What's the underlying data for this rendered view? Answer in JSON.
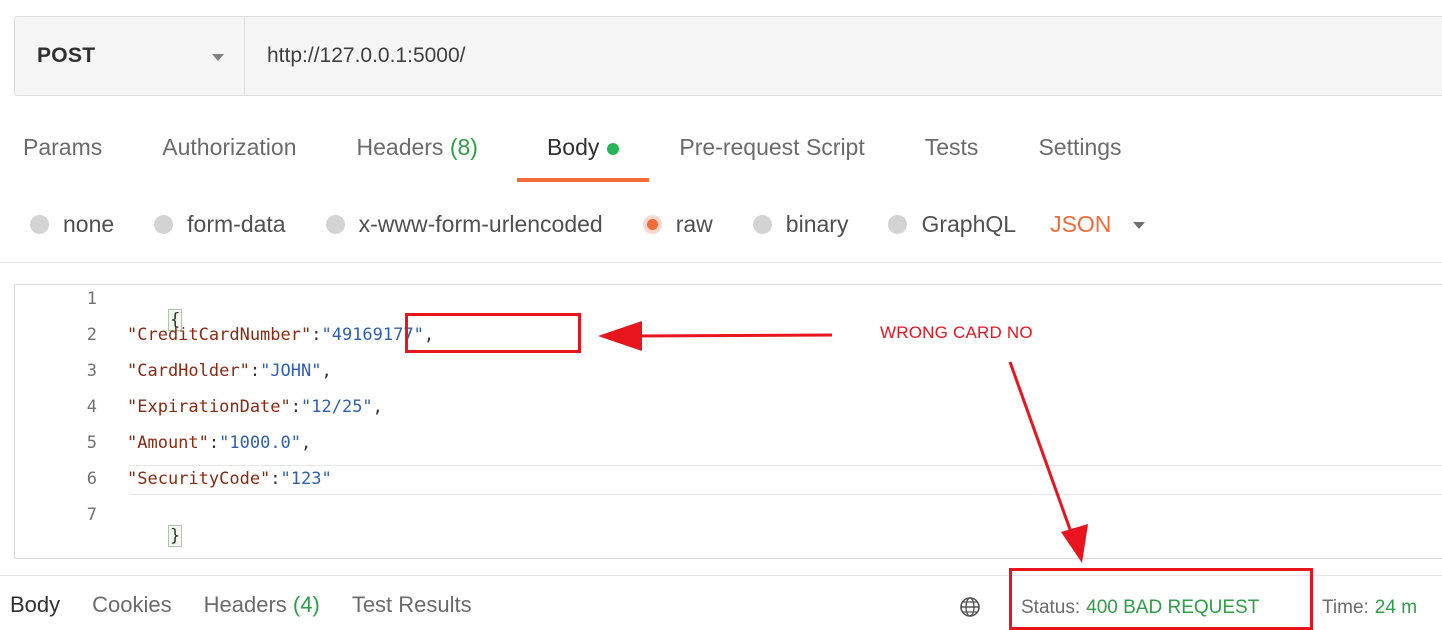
{
  "request": {
    "method": "POST",
    "url": "http://127.0.0.1:5000/"
  },
  "tabs": [
    {
      "label": "Params"
    },
    {
      "label": "Authorization"
    },
    {
      "label": "Headers",
      "count": "(8)"
    },
    {
      "label": "Body",
      "active": true
    },
    {
      "label": "Pre-request Script"
    },
    {
      "label": "Tests"
    },
    {
      "label": "Settings"
    }
  ],
  "body_modes": {
    "options": [
      "none",
      "form-data",
      "x-www-form-urlencoded",
      "raw",
      "binary",
      "GraphQL"
    ],
    "selected": "raw",
    "format": "JSON"
  },
  "editor": {
    "line_numbers": [
      "1",
      "2",
      "3",
      "4",
      "5",
      "6",
      "7"
    ],
    "lines": [
      {
        "open": "{"
      },
      {
        "key": "\"CreditCardNumber\"",
        "sep": ":",
        "value": "\"49169177\"",
        "tail": ","
      },
      {
        "key": "\"CardHolder\"",
        "sep": ":",
        "value": "\"JOHN\"",
        "tail": ","
      },
      {
        "key": "\"ExpirationDate\"",
        "sep": ":",
        "value": "\"12/25\"",
        "tail": ","
      },
      {
        "key": "\"Amount\"",
        "sep": ":",
        "value": "\"1000.0\"",
        "tail": ","
      },
      {
        "key": "\"SecurityCode\"",
        "sep": ":",
        "value": "\"123\"",
        "tail": ""
      },
      {
        "close": "}"
      }
    ]
  },
  "annotation": {
    "text": "WRONG CARD NO",
    "color": "#e8141e"
  },
  "response": {
    "tabs": [
      {
        "label": "Body",
        "active": true
      },
      {
        "label": "Cookies"
      },
      {
        "label": "Headers",
        "count": "(4)"
      },
      {
        "label": "Test Results"
      }
    ],
    "status_label": "Status:",
    "status_value": "400 BAD REQUEST",
    "time_label": "Time:",
    "time_value": "24 m"
  },
  "colors": {
    "accent": "#f26b3a",
    "success": "#2e9e47",
    "annotation": "#e8141e"
  }
}
